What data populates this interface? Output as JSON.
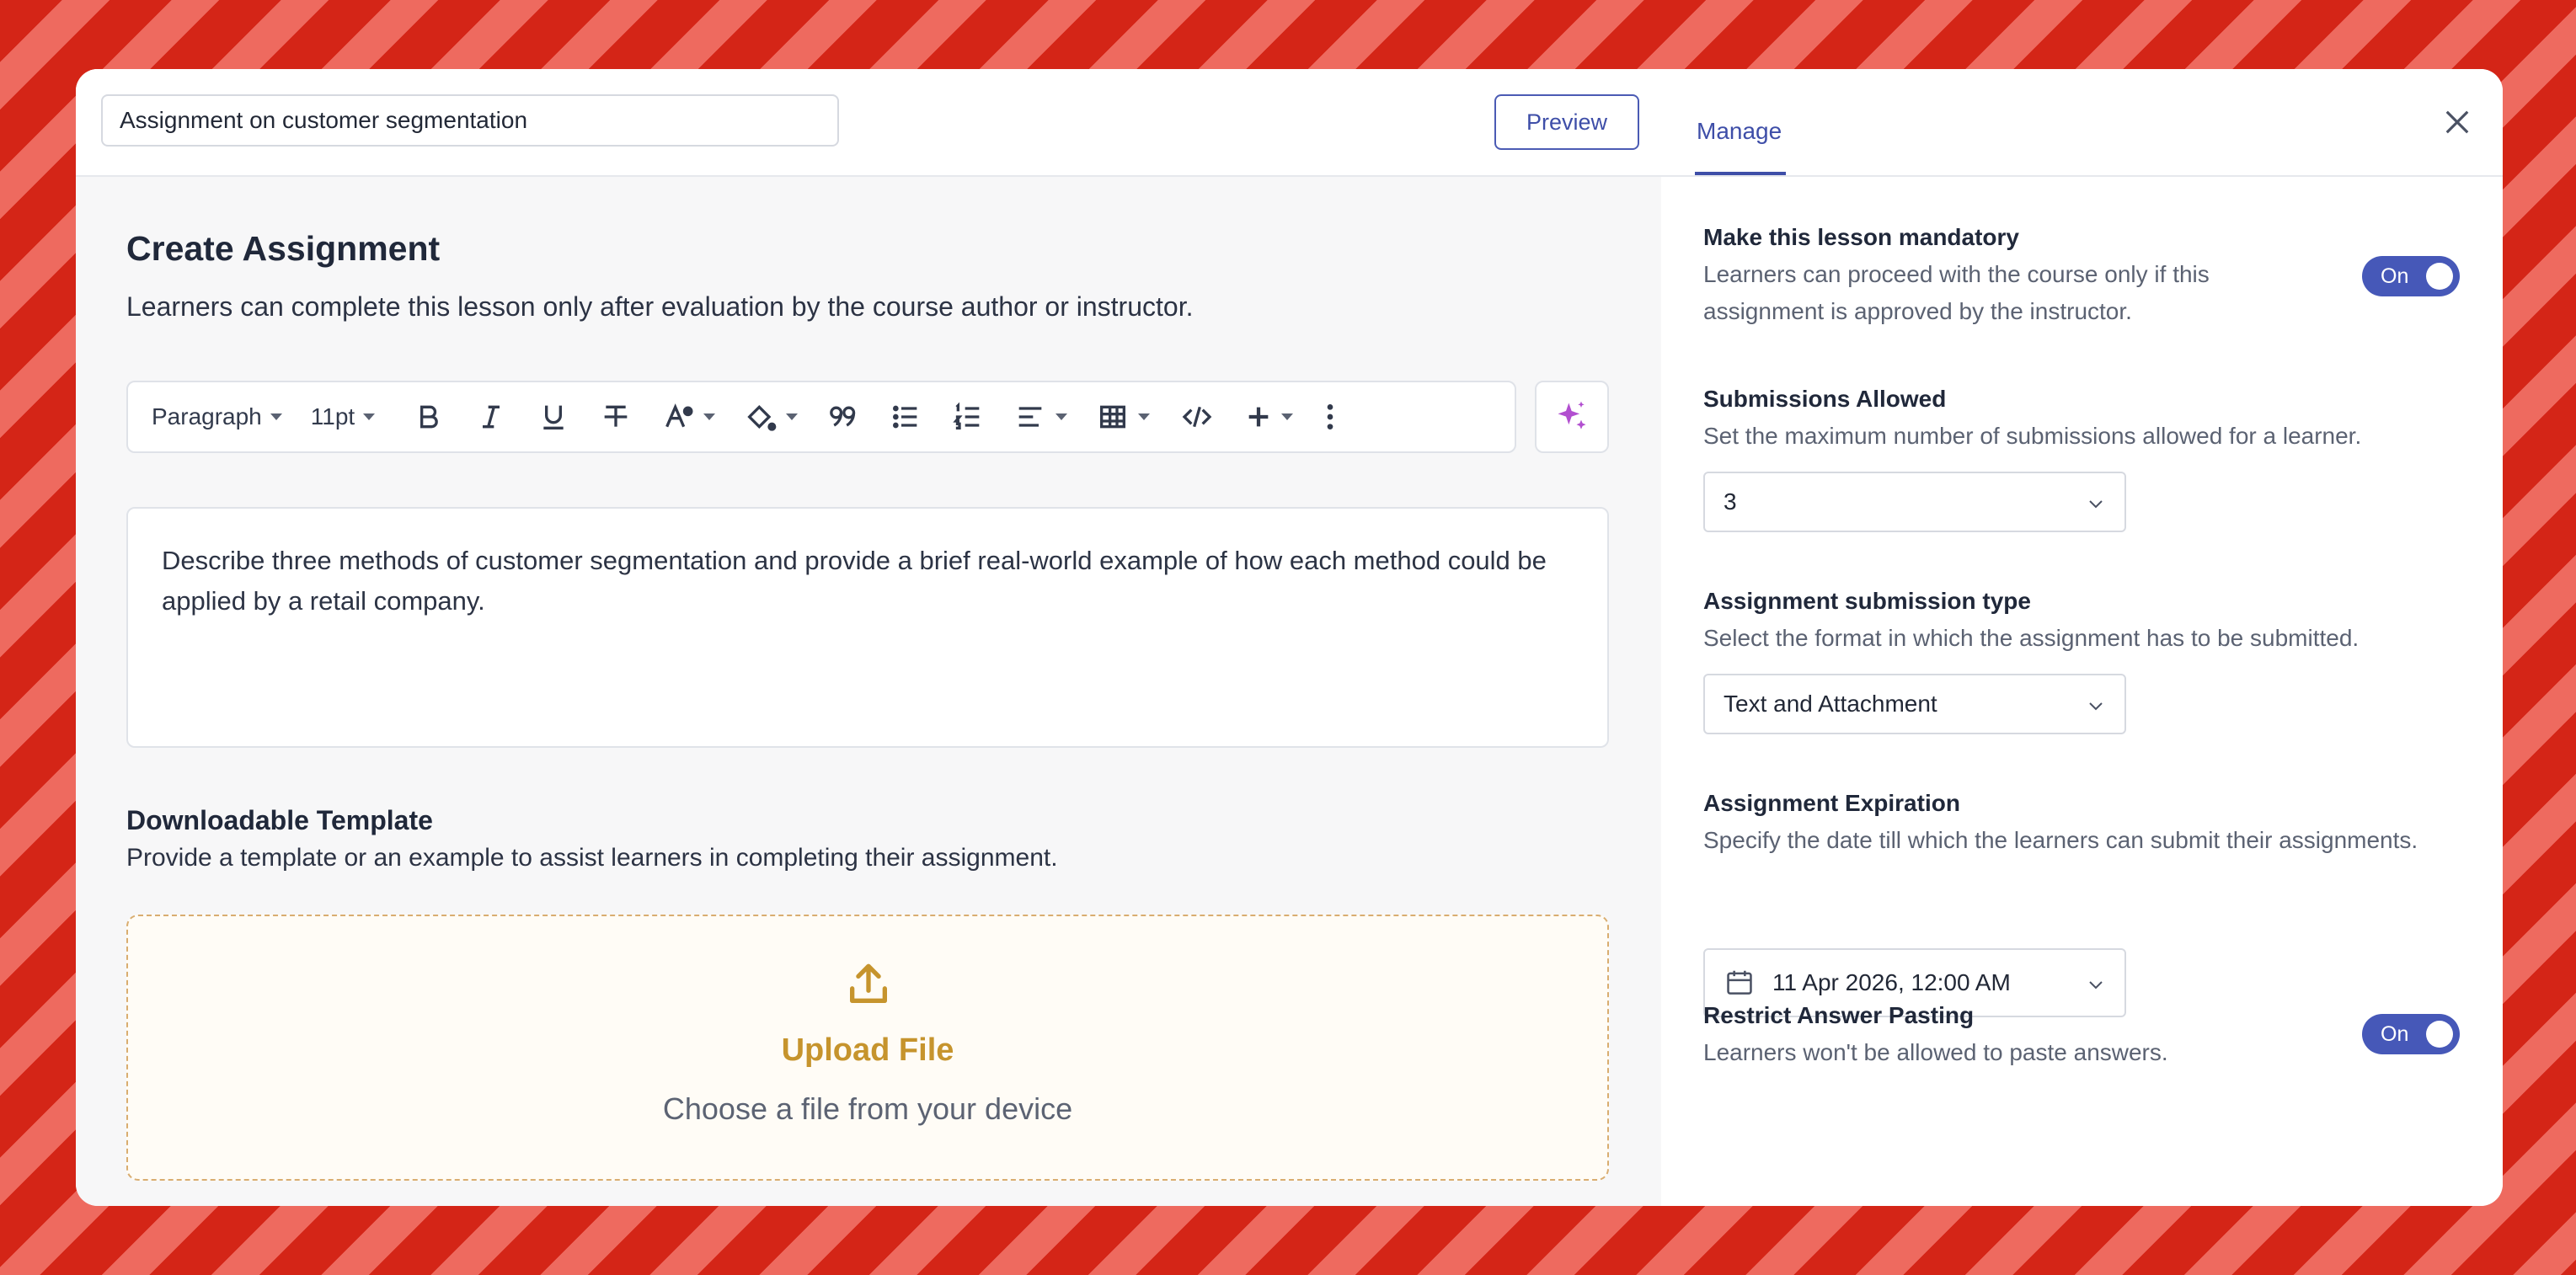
{
  "editor": {
    "title_value": "Assignment on customer segmentation",
    "preview_label": "Preview",
    "heading": "Create Assignment",
    "subheading": "Learners can complete this lesson only after evaluation by the course author or instructor.",
    "toolbar": {
      "paragraph_label": "Paragraph",
      "font_size_label": "11pt",
      "icons": [
        "bold-icon",
        "italic-icon",
        "underline-icon",
        "strikethrough-icon",
        "font-color-icon",
        "highlight-icon",
        "quote-icon",
        "bullet-list-icon",
        "numbered-list-icon",
        "align-icon",
        "table-icon",
        "code-icon",
        "insert-icon",
        "more-icon"
      ]
    },
    "ai_icon": "sparkle-icon",
    "content": "Describe three methods of customer segmentation and provide a brief real-world example of how each method could be applied by a retail company.",
    "template_heading": "Downloadable Template",
    "template_desc": "Provide a template or an example to assist learners in completing their assignment.",
    "upload_title": "Upload File",
    "upload_sub": "Choose a file from your device"
  },
  "panel": {
    "tab_label": "Manage",
    "mandatory": {
      "title": "Make this lesson mandatory",
      "desc_line1": "Learners can proceed with the course only if this",
      "desc_line2": "assignment is approved by the instructor.",
      "toggle": "On"
    },
    "submissions": {
      "title": "Submissions Allowed",
      "desc": "Set the maximum number of submissions allowed for a learner.",
      "value": "3"
    },
    "submission_type": {
      "title": "Assignment submission type",
      "desc": "Select the format in which the assignment has to be submitted.",
      "value": "Text and Attachment"
    },
    "expiration": {
      "title": "Assignment Expiration",
      "desc": "Specify the date till which the learners can submit their assignments.",
      "value": "11 Apr 2026, 12:00 AM"
    },
    "restrict": {
      "title": "Restrict Answer Pasting",
      "desc": "Learners won't be allowed to paste answers.",
      "toggle": "On"
    }
  },
  "colors": {
    "background_red": "#d42517",
    "stripe": "#ee6a5f",
    "accent": "#4658b8",
    "upload_gold": "#c6942d"
  }
}
